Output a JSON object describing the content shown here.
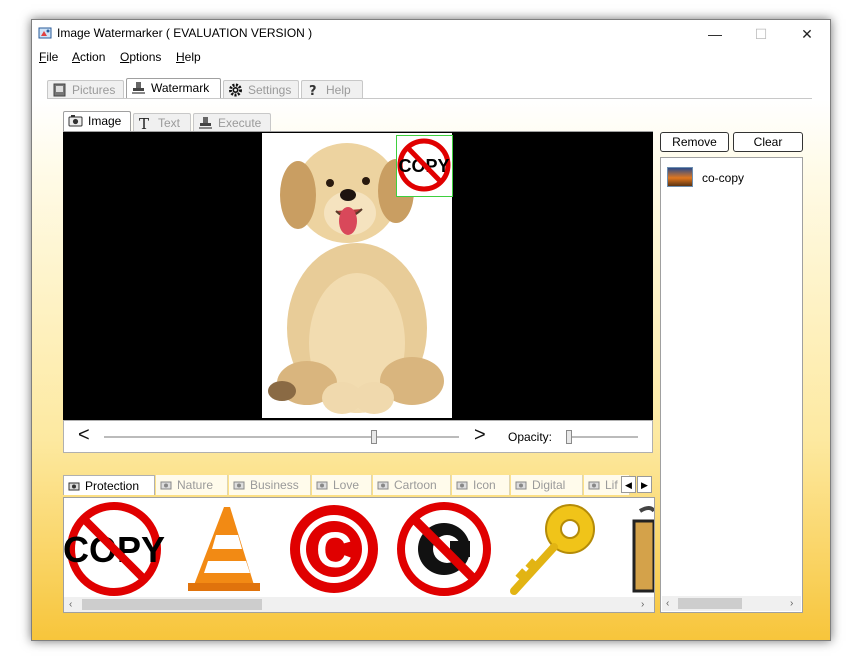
{
  "window": {
    "title": "Image Watermarker ( EVALUATION VERSION )"
  },
  "caption": {
    "minimize": "—",
    "maximize": "☐",
    "close": "✕"
  },
  "menu": [
    {
      "key": "F",
      "rest": "ile"
    },
    {
      "key": "A",
      "rest": "ction"
    },
    {
      "key": "O",
      "rest": "ptions"
    },
    {
      "key": "H",
      "rest": "elp"
    }
  ],
  "main_tabs": {
    "pictures": "Pictures",
    "watermark": "Watermark",
    "settings": "Settings",
    "help": "Help",
    "active": "Watermark"
  },
  "sub_tabs": {
    "image": "Image",
    "text": "Text",
    "execute": "Execute",
    "active": "Image"
  },
  "preview": {
    "watermark_text": "COPY",
    "prev": "<",
    "next": ">",
    "position_slider": 0.76,
    "opacity_label": "Opacity:",
    "opacity_slider": 0.0
  },
  "watermark_list": {
    "remove_label": "Remove",
    "clear_label": "Clear",
    "items": [
      {
        "label": "co-copy"
      }
    ]
  },
  "categories": {
    "tabs": [
      "Protection",
      "Nature",
      "Business",
      "Love",
      "Cartoon",
      "Icon",
      "Digital",
      "Lif"
    ],
    "active": "Protection",
    "scroll_left": "◀",
    "scroll_right": "▶"
  },
  "gallery": {
    "items": [
      "copy-sign",
      "traffic-cone",
      "copyright-symbol",
      "no-copyright-sign",
      "key",
      "padlock-partial"
    ],
    "copy_text": "COPY",
    "copyright_glyph": "C"
  },
  "scroll": {
    "left": "‹",
    "right": "›"
  },
  "colors": {
    "accent_yellow": "#f7c53b",
    "ban_red": "#e00000",
    "selection_green": "#3ecf3e"
  }
}
